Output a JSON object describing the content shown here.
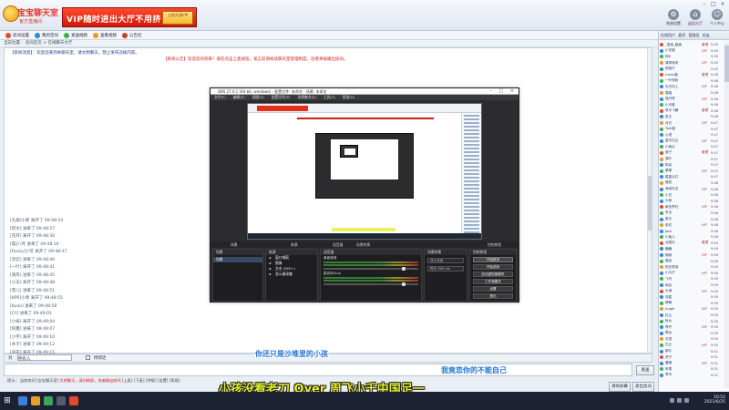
{
  "header": {
    "logo_name": "宝宝聊天室",
    "logo_sub": "官方直播间",
    "vip_text": "VIP随时进出大厅不用挤",
    "vip_chip": "立即开通VIP",
    "icons": [
      {
        "label": "系统设置",
        "icon": "gear-icon"
      },
      {
        "label": "返回大厅",
        "icon": "home-icon"
      },
      {
        "label": "个人中心",
        "icon": "user-icon"
      }
    ]
  },
  "toolbar": {
    "items": [
      {
        "label": "房间设置",
        "color": "#e24a2e"
      },
      {
        "label": "我的空间",
        "color": "#2a8ad6"
      },
      {
        "label": "发送视频",
        "color": "#3bb04a"
      },
      {
        "label": "查看视频",
        "color": "#e89a16"
      },
      {
        "label": "公告栏",
        "color": "#c2402a"
      }
    ]
  },
  "breadcrumb": "当前位置：  房间首页  >  在线聊天大厅",
  "chat": {
    "notice": "【系统消息】：欢迎您来到本聊天室，请文明聊天，禁止发布违规内容。",
    "notice_red": "【系统公告】欢迎您的到来！请先点击上麦按钮，发言前请阅读聊天室管理制度，违者将被踢出房间。"
  },
  "history": [
    "[九歌]小新  离开了 09:48:24",
    "[阿文]  进来了 09:48:27",
    "[花开]  离开了 09:48:30",
    "[孤]八月  进来了 09:48:34",
    "[Fanny]小可  离开了 09:48:37",
    "[流云]  进来了 09:48:40",
    "[一叶]  离开了 09:48:41",
    "[清风]  进来了 09:48:45",
    "[小天]  离开了 09:48:48",
    "[雪儿]  进来了 09:48:51",
    "[KPR]小周  离开了 09:48:55",
    "[Kudo]  进来了 09:48:58",
    "[CY]  进来了 09:49:01",
    "[小妹]  离开了 09:49:04",
    "[阿鑫]  进来了 09:49:07",
    "[小宇]  离开了 09:49:10",
    "[木子]  进来了 09:49:12",
    "[浪花]  离开了 09:49:15"
  ],
  "obs": {
    "title": "OBS 27.0.1 (64-bit, windows) - 配置文件: 未命名 - 场景: 未命名",
    "menu": [
      "文件(F)",
      "编辑(E)",
      "视图(V)",
      "配置文件(P)",
      "场景集合(S)",
      "工具(T)",
      "帮助(H)"
    ],
    "dock_tabs": [
      "场景",
      "来源",
      "混音器",
      "场景转换",
      "控制按钮"
    ],
    "scenes_header": "场景",
    "scene_item": "场景",
    "sources_header": "来源",
    "sources": [
      "窗口捕获",
      "图像",
      "文本 (GDI+)",
      "显示器采集"
    ],
    "mixer_header": "混音器",
    "mixer_channels": [
      "桌面音频",
      "麦克风/Aux"
    ],
    "transitions_header": "场景转换",
    "transition_type": "淡入淡出",
    "transition_duration": "时长  300 ms",
    "controls_header": "控制按钮",
    "controls": [
      "开始推流",
      "开始录制",
      "启动虚拟摄像机",
      "工作室模式",
      "设置",
      "退出"
    ]
  },
  "input_bar": {
    "to_label": "对",
    "target": "所有人",
    "private_label": "悄悄话"
  },
  "send_label": "发送",
  "status": {
    "prefix": "提示：  当前房间  [宝宝聊天室]",
    "alert": "  文明聊天，请勿刷屏，违者踢出房间",
    "suffix": "  [上麦] [下麦]  [举报]  [设置]  [帮助]"
  },
  "bottom_buttons": [
    "清除屏幕",
    "退出房间"
  ],
  "user_panel": {
    "tabs": [
      "在线用户",
      "麦序",
      "管理员",
      "好友"
    ],
    "users": [
      {
        "name": "_宝宝_超级",
        "tag": "管理",
        "time": "9:45",
        "color": "#e04a2a"
      },
      {
        "name": "小花猫",
        "tag": "VIP",
        "time": "9:45",
        "color": "#2a8ad6"
      },
      {
        "name": "阿K",
        "tag": "",
        "time": "9:45",
        "color": "#3bb04a"
      },
      {
        "name": "清风徐来",
        "tag": "VIP",
        "time": "9:45",
        "color": "#e89a16"
      },
      {
        "name": "夜猫子",
        "tag": "",
        "time": "9:45",
        "color": "#2a8ad6"
      },
      {
        "name": "Lucky星",
        "tag": "管理",
        "time": "9:46",
        "color": "#e04a2a"
      },
      {
        "name": "一叶知秋",
        "tag": "",
        "time": "9:46",
        "color": "#3bb04a"
      },
      {
        "name": "天天向上",
        "tag": "VIP",
        "time": "9:46",
        "color": "#2a8ad6"
      },
      {
        "name": "喵喵",
        "tag": "",
        "time": "9:46",
        "color": "#e89a16"
      },
      {
        "name": "独行侠",
        "tag": "VIP",
        "time": "9:46",
        "color": "#2a8ad6"
      },
      {
        "name": "小可爱",
        "tag": "",
        "time": "9:46",
        "color": "#3bb04a"
      },
      {
        "name": "风中飞舞",
        "tag": "管理",
        "time": "9:46",
        "color": "#e04a2a"
      },
      {
        "name": "老王",
        "tag": "",
        "time": "9:46",
        "color": "#2a8ad6"
      },
      {
        "name": "月光",
        "tag": "VIP",
        "time": "9:47",
        "color": "#e89a16"
      },
      {
        "name": "Tom猫",
        "tag": "",
        "time": "9:47",
        "color": "#3bb04a"
      },
      {
        "name": "心语",
        "tag": "",
        "time": "9:47",
        "color": "#2a8ad6"
      },
      {
        "name": "蓝天白云",
        "tag": "VIP",
        "time": "9:47",
        "color": "#2a8ad6"
      },
      {
        "name": "小雨点",
        "tag": "",
        "time": "9:47",
        "color": "#3bb04a"
      },
      {
        "name": "浪子",
        "tag": "管理",
        "time": "9:47",
        "color": "#e04a2a"
      },
      {
        "name": "落叶",
        "tag": "",
        "time": "9:47",
        "color": "#e89a16"
      },
      {
        "name": "阿呆",
        "tag": "",
        "time": "9:47",
        "color": "#2a8ad6"
      },
      {
        "name": "果果",
        "tag": "VIP",
        "time": "9:47",
        "color": "#3bb04a"
      },
      {
        "name": "星星点灯",
        "tag": "",
        "time": "9:47",
        "color": "#2a8ad6"
      },
      {
        "name": "微笑",
        "tag": "",
        "time": "9:48",
        "color": "#e89a16"
      },
      {
        "name": "海阔天空",
        "tag": "VIP",
        "time": "9:48",
        "color": "#2a8ad6"
      },
      {
        "name": "小白",
        "tag": "",
        "time": "9:48",
        "color": "#3bb04a"
      },
      {
        "name": "大熊",
        "tag": "",
        "time": "9:48",
        "color": "#2a8ad6"
      },
      {
        "name": "紫色梦幻",
        "tag": "VIP",
        "time": "9:48",
        "color": "#e04a2a"
      },
      {
        "name": "冬瓜",
        "tag": "",
        "time": "9:48",
        "color": "#3bb04a"
      },
      {
        "name": "夏天",
        "tag": "",
        "time": "9:48",
        "color": "#2a8ad6"
      },
      {
        "name": "彩虹",
        "tag": "VIP",
        "time": "9:48",
        "color": "#e89a16"
      },
      {
        "name": "Jack",
        "tag": "",
        "time": "9:48",
        "color": "#2a8ad6"
      },
      {
        "name": "小鱼儿",
        "tag": "",
        "time": "9:48",
        "color": "#3bb04a"
      },
      {
        "name": "北极光",
        "tag": "管理",
        "time": "9:49",
        "color": "#e04a2a"
      },
      {
        "name": "糖糖",
        "tag": "",
        "time": "9:49",
        "color": "#2a8ad6"
      },
      {
        "name": "烟雨",
        "tag": "VIP",
        "time": "9:49",
        "color": "#2a8ad6"
      },
      {
        "name": "墨染",
        "tag": "",
        "time": "9:49",
        "color": "#3bb04a"
      },
      {
        "name": "阳光男孩",
        "tag": "",
        "time": "9:49",
        "color": "#e89a16"
      },
      {
        "name": "小丸子",
        "tag": "VIP",
        "time": "9:49",
        "color": "#2a8ad6"
      },
      {
        "name": "飞鸟",
        "tag": "",
        "time": "9:49",
        "color": "#3bb04a"
      },
      {
        "name": "雨后",
        "tag": "",
        "time": "9:49",
        "color": "#2a8ad6"
      },
      {
        "name": "大海",
        "tag": "VIP",
        "time": "9:49",
        "color": "#e04a2a"
      },
      {
        "name": "流星",
        "tag": "",
        "time": "9:50",
        "color": "#2a8ad6"
      },
      {
        "name": "萌萌",
        "tag": "",
        "time": "9:50",
        "color": "#3bb04a"
      },
      {
        "name": "Angel",
        "tag": "VIP",
        "time": "9:50",
        "color": "#e89a16"
      },
      {
        "name": "红尘",
        "tag": "",
        "time": "9:50",
        "color": "#2a8ad6"
      },
      {
        "name": "秋水",
        "tag": "",
        "time": "9:50",
        "color": "#3bb04a"
      },
      {
        "name": "青柠",
        "tag": "VIP",
        "time": "9:50",
        "color": "#2a8ad6"
      },
      {
        "name": "寒冰",
        "tag": "",
        "time": "9:50",
        "color": "#2a8ad6"
      },
      {
        "name": "花语",
        "tag": "",
        "time": "9:50",
        "color": "#e89a16"
      },
      {
        "name": "白云",
        "tag": "VIP",
        "time": "9:50",
        "color": "#3bb04a"
      },
      {
        "name": "蜗牛",
        "tag": "",
        "time": "9:51",
        "color": "#2a8ad6"
      },
      {
        "name": "虎子",
        "tag": "",
        "time": "9:51",
        "color": "#e04a2a"
      },
      {
        "name": "晨曦",
        "tag": "VIP",
        "time": "9:51",
        "color": "#2a8ad6"
      },
      {
        "name": "苹果",
        "tag": "",
        "time": "9:51",
        "color": "#3bb04a"
      },
      {
        "name": "青鸟",
        "tag": "",
        "time": "9:51",
        "color": "#2a8ad6"
      }
    ]
  },
  "subtitles": {
    "line1": "你还只是沙堆里的小孩",
    "line2": "我竟恋你的不能自己",
    "line3": "小孩没看老刀 Over 周飞小千中国足一"
  },
  "taskbar": {
    "time": "10:52",
    "date": "2021/6/25"
  }
}
